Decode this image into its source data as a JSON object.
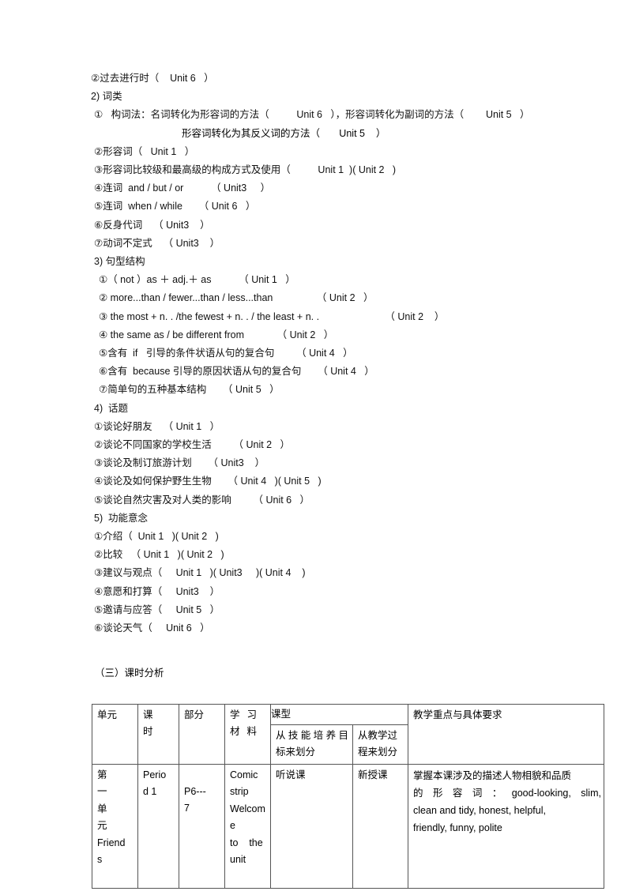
{
  "document": {
    "grammar_section": {
      "tense_item": "②过去进行时（    Unit 6   ）",
      "word_class_heading": "2) 词类",
      "word_formation_line1": "①   构词法：名词转化为形容词的方法（          Unit 6   ），形容词转化为副词的方法（        Unit 5   ）",
      "word_formation_line2": "形容词转化为其反义词的方法（       Unit 5    ）",
      "items": [
        "②形容词（   Unit 1   ）",
        "③形容词比较级和最高级的构成方式及使用（          Unit 1  )( Unit 2   )",
        "④连词  and / but / or          （ Unit3     ）",
        "⑤连词  when / while      （ Unit 6   ）",
        "⑥反身代词    （ Unit3    ）",
        "⑦动词不定式    （ Unit3    ）"
      ]
    },
    "sentence_structure_section": {
      "heading": "3) 句型结构",
      "items": [
        "①（ not ）as ＋ adj.＋ as          （ Unit 1   ）",
        "② more...than / fewer...than / less...than                （ Unit 2   ）",
        "③ the most + n. . /the fewest + n. . / the least + n. .                        （ Unit 2    ）",
        "④ the same as / be different from            （ Unit 2   ）",
        "⑤含有  if   引导的条件状语从句的复合句        （ Unit 4   ）",
        "⑥含有  because 引导的原因状语从句的复合句      （ Unit 4   ）",
        "⑦简单句的五种基本结构      （ Unit 5   ）"
      ]
    },
    "topic_section": {
      "heading": "4)  话题",
      "items": [
        "①谈论好朋友    （ Unit 1   ）",
        "②谈论不同国家的学校生活        （ Unit 2   ）",
        "③谈论及制订旅游计划      （ Unit3    ）",
        "④谈论及如何保护野生生物      （ Unit 4   )( Unit 5   )",
        "⑤谈论自然灾害及对人类的影响        （ Unit 6   ）"
      ]
    },
    "function_section": {
      "heading": "5)  功能意念",
      "items": [
        "①介绍（  Unit 1   )( Unit 2   )",
        "②比较   （ Unit 1   )( Unit 2   )",
        "③建议与观点（     Unit 1   )( Unit3     )( Unit 4    )",
        "④意愿和打算（     Unit3    ）",
        "⑤邀请与应答（     Unit 5   ）",
        "⑥谈论天气（     Unit 6   ）"
      ]
    },
    "analysis_heading": "（三）课时分析",
    "table": {
      "headers": {
        "unit": "单元",
        "period_top": "课",
        "period_bottom": "时",
        "part": "部分",
        "material_top_a": "学",
        "material_top_b": "习",
        "material_bottom_a": "材",
        "material_bottom_b": "料",
        "lesson_type_group": "课型",
        "skill_line1_chars": [
          "从",
          "技",
          "能",
          "培",
          "养",
          "目"
        ],
        "skill_line2": "标来划分",
        "process_line1": "从教学过",
        "process_line2": "程来划分",
        "focus": "教学重点与具体要求"
      },
      "rows": [
        {
          "unit_lines": [
            "第",
            "一",
            "单",
            "元",
            "Friend",
            "s"
          ],
          "period_lines": [
            "Perio",
            "d 1"
          ],
          "part_lines": [
            "P6---",
            "7"
          ],
          "material_lines": [
            "Comic",
            "strip",
            "Welcom",
            "e",
            "to    the",
            "unit"
          ],
          "skill": "听说课",
          "process": "新授课",
          "focus_line1": "掌握本课涉及的描述人物相貌和品质",
          "focus_line2_chars": [
            "的",
            "形",
            "容",
            "词",
            "：",
            "good-looking,"
          ],
          "focus_line2_tail": "slim,",
          "focus_line3": "clean and tidy, honest, helpful,",
          "focus_line4": "friendly, funny, polite"
        }
      ]
    }
  }
}
